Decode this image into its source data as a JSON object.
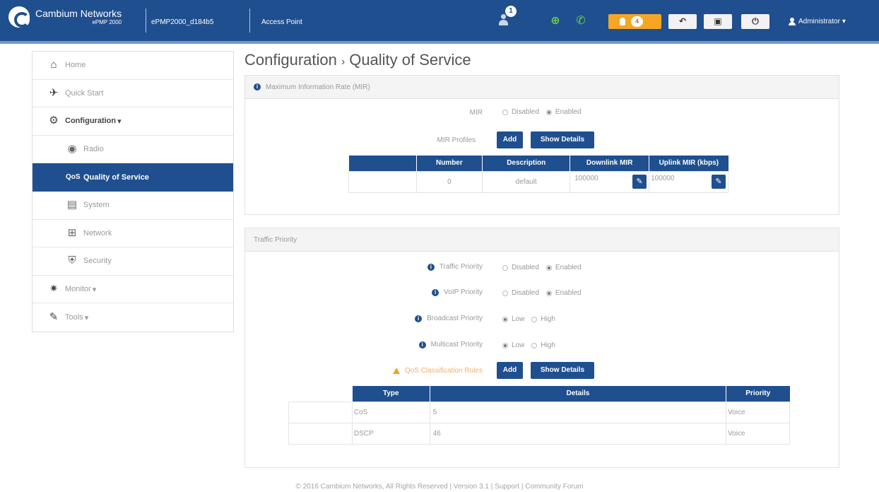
{
  "header": {
    "brand_name": "Cambium Networks",
    "brand_model": "ePMP 2000",
    "device_name": "ePMP2000_d184b5",
    "device_mode": "Access Point",
    "notification_count": "1",
    "alert_count": "4",
    "user_label": "Administrator",
    "accent_color": "#1f4f8f",
    "alert_color": "#f7a623"
  },
  "sidebar": {
    "items": [
      {
        "label": "Home",
        "icon": "home-icon"
      },
      {
        "label": "Quick Start",
        "icon": "runner-icon"
      },
      {
        "label": "Configuration",
        "icon": "gear-icon"
      },
      {
        "label": "Radio",
        "icon": "radio-icon"
      },
      {
        "label": "Quality of Service",
        "icon": "qos-icon"
      },
      {
        "label": "System",
        "icon": "system-icon"
      },
      {
        "label": "Network",
        "icon": "network-icon"
      },
      {
        "label": "Security",
        "icon": "shield-icon"
      },
      {
        "label": "Monitor",
        "icon": "pulse-icon"
      },
      {
        "label": "Tools",
        "icon": "wrench-icon"
      }
    ]
  },
  "page": {
    "title_section": "Configuration",
    "title_page": "Quality of Service"
  },
  "mir_panel": {
    "heading": "Maximum Information Rate (MIR)",
    "mir_label": "MIR",
    "mir_options": [
      "Disabled",
      "Enabled"
    ],
    "mir_selected": "Enabled",
    "profiles_label": "MIR Profiles",
    "add_label": "Add",
    "details_label": "Show Details",
    "table_headers": [
      "Number",
      "Description",
      "Downlink MIR",
      "Uplink MIR (kbps)"
    ],
    "table_rows": [
      {
        "number": "0",
        "description": "default",
        "downlink": "100000",
        "uplink": "100000"
      }
    ]
  },
  "traffic_panel": {
    "heading": "Traffic Priority",
    "traffic_priority_label": "Traffic Priority",
    "traffic_priority_selected": "Enabled",
    "voip_priority_label": "VoIP Priority",
    "voip_priority_selected": "Enabled",
    "enable_options": [
      "Disabled",
      "Enabled"
    ],
    "broadcast_priority_label": "Broadcast Priority",
    "broadcast_priority_selected": "Low",
    "multicast_priority_label": "Multicast Priority",
    "multicast_priority_selected": "Low",
    "level_options": [
      "Low",
      "High"
    ],
    "rules_label": "QoS Classification Rules",
    "add_label": "Add",
    "details_label": "Show Details",
    "table_headers": [
      "Type",
      "Details",
      "Priority"
    ],
    "table_rows": [
      {
        "type": "CoS",
        "details": "5",
        "priority": "Voice"
      },
      {
        "type": "DSCP",
        "details": "46",
        "priority": "Voice"
      }
    ]
  },
  "footer": {
    "copyright": "© 2016 Cambium Networks, All Rights Reserved",
    "version": "Version 3.1",
    "support": "Support",
    "forum": "Community Forum"
  }
}
